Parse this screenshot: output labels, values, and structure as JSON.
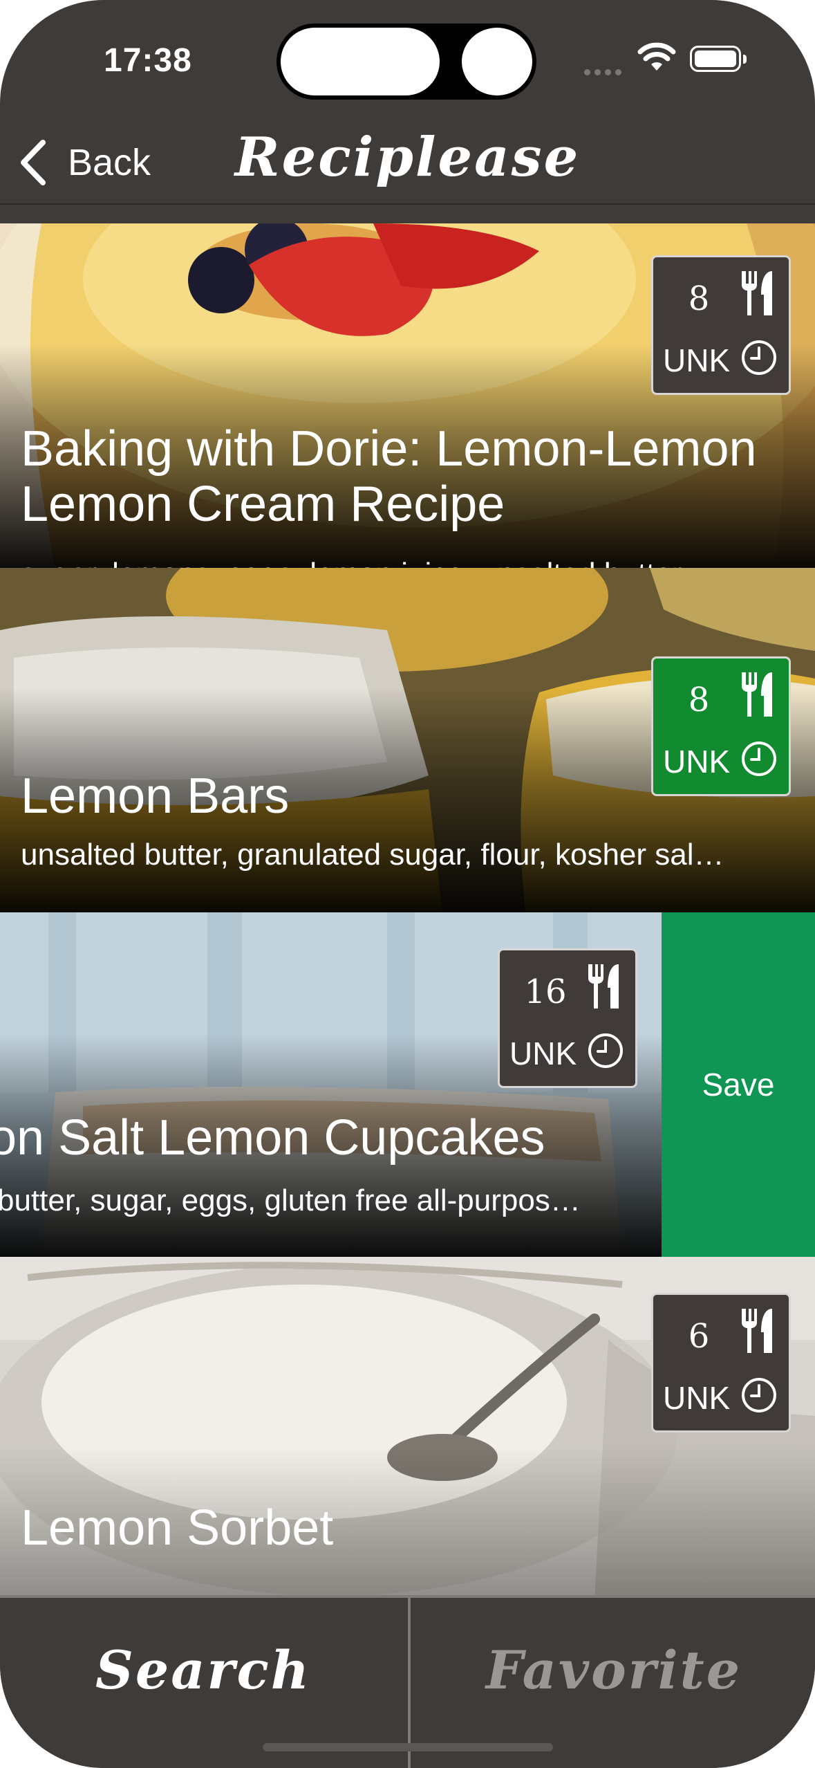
{
  "status_bar": {
    "time": "17:38"
  },
  "nav": {
    "back_label": "Back",
    "title": "Reciplease"
  },
  "recipes": [
    {
      "title": "Baking with Dorie: Lemon-Lemon Lemon Cream Recipe",
      "ingredients": "sugar, lemons, eggs, lemon juice, unsalted butter,…",
      "yield": "8",
      "time": "UNK",
      "badge_color": "#403b39"
    },
    {
      "title": "Lemon Bars",
      "ingredients": "unsalted butter, granulated sugar, flour, kosher sal…",
      "yield": "8",
      "time": "UNK",
      "badge_color": "#128a2f"
    },
    {
      "title": "on Salt Lemon Cupcakes",
      "ingredients": "butter, sugar, eggs, gluten free all-purpos…",
      "yield": "16",
      "time": "UNK",
      "badge_color": "#403b39",
      "swipe_action": "Save"
    },
    {
      "title": "Lemon Sorbet",
      "ingredients": "",
      "yield": "6",
      "time": "UNK",
      "badge_color": "#403b39"
    }
  ],
  "tabs": [
    {
      "label": "Search",
      "selected": true
    },
    {
      "label": "Favorite",
      "selected": false
    }
  ],
  "colors": {
    "background": "#3f3b39",
    "save_action": "#0f9655",
    "tab_selected": "#ffffff",
    "tab_unselected": "#9a9795"
  }
}
